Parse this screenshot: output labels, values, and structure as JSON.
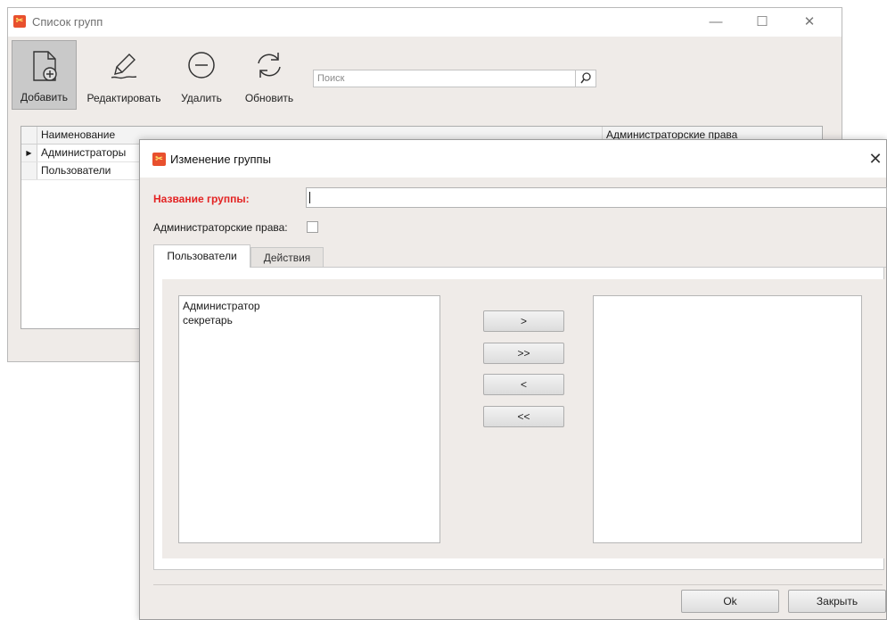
{
  "colors": {
    "accent_label": "#e32222",
    "panel_bg": "#efebe8",
    "app_icon": "#e8502e"
  },
  "list_window": {
    "title": "Список групп",
    "window_controls": {
      "minimize": "—",
      "maximize": "☐",
      "close": "✕"
    },
    "toolbar": {
      "add_label": "Добавить",
      "edit_label": "Редактировать",
      "delete_label": "Удалить",
      "refresh_label": "Обновить"
    },
    "search": {
      "placeholder": "Поиск"
    },
    "grid": {
      "columns": [
        "Наименование",
        "Администраторские права"
      ],
      "rows": [
        {
          "name": "Администраторы",
          "current": true
        },
        {
          "name": "Пользователи",
          "current": false
        }
      ],
      "row_indicator": "▶"
    }
  },
  "dialog": {
    "title": "Изменение группы",
    "close": "✕",
    "name_label": "Название группы:",
    "name_value": "",
    "admin_label": "Администраторские права:",
    "admin_checked": false,
    "tabs": [
      "Пользователи",
      "Действия"
    ],
    "available_users": [
      "Администратор",
      "секретарь"
    ],
    "selected_users": [],
    "move_buttons": {
      "add_one": ">",
      "add_all": ">>",
      "remove_one": "<",
      "remove_all": "<<"
    },
    "ok_label": "Ok",
    "close_label": "Закрыть"
  }
}
